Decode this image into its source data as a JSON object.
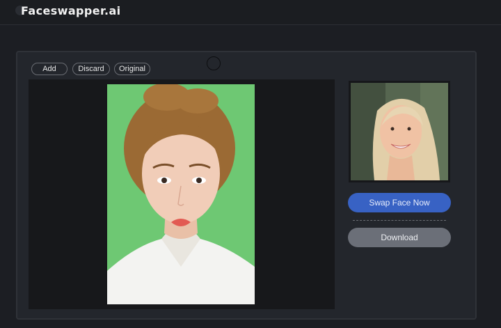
{
  "header": {
    "logo_text": "Faceswapper.ai"
  },
  "toolbar": {
    "add_label": "Add",
    "discard_label": "Discard",
    "original_label": "Original"
  },
  "actions": {
    "swap_label": "Swap Face Now",
    "download_label": "Download"
  },
  "colors": {
    "accent": "#3862c4",
    "panel": "#23262c",
    "canvas": "#17181b",
    "target_bg": "#6ec873"
  }
}
